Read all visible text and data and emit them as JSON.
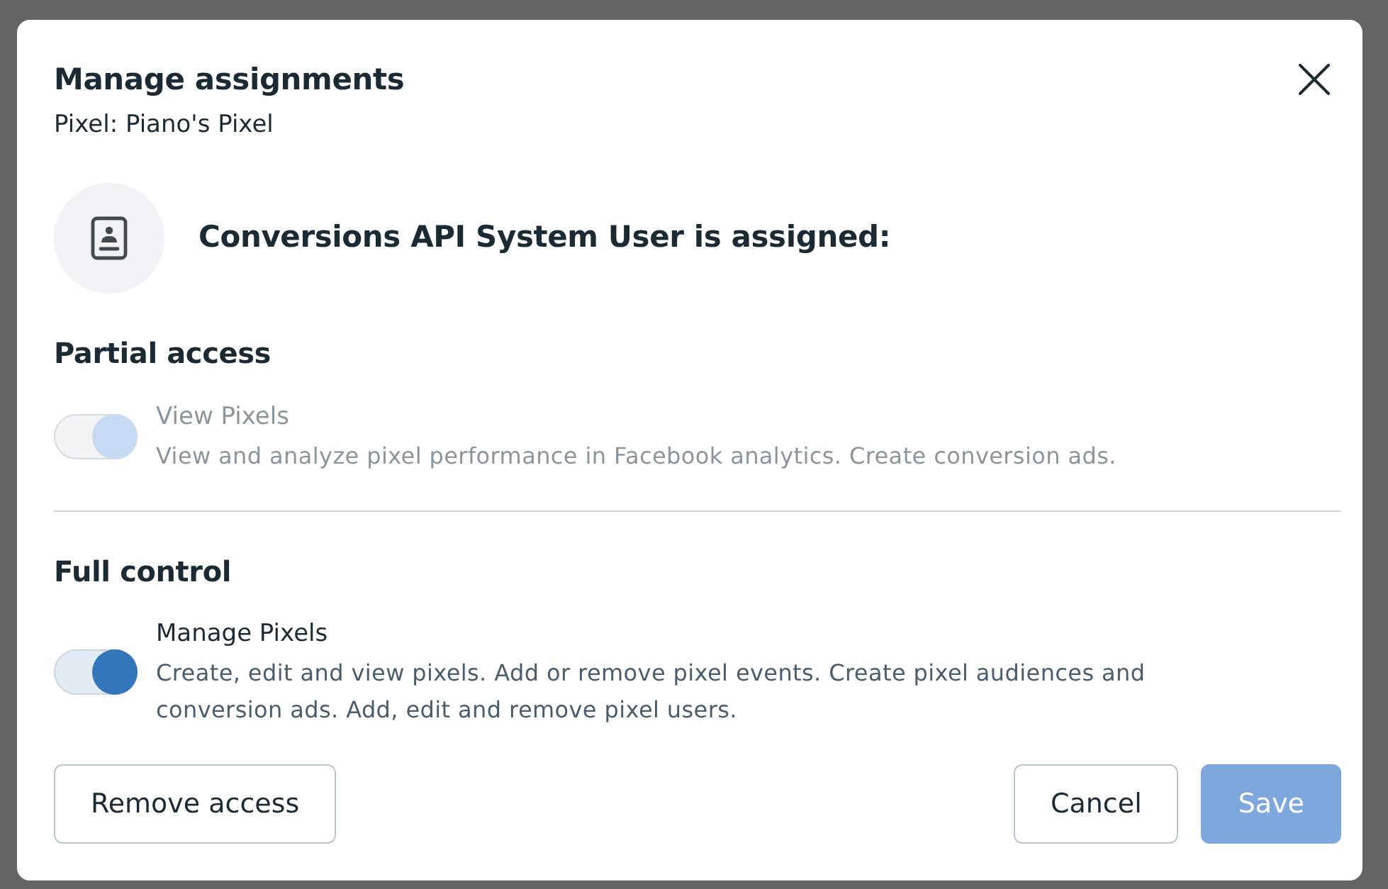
{
  "dialog": {
    "title": "Manage assignments",
    "subtitle": "Pixel: Piano's Pixel",
    "heading": "Conversions API System User is assigned:",
    "sections": [
      {
        "title": "Partial access",
        "permissions": [
          {
            "label": "View Pixels",
            "description": "View and analyze pixel performance in Facebook analytics. Create conversion ads.",
            "on": true,
            "disabled": true
          }
        ]
      },
      {
        "title": "Full control",
        "permissions": [
          {
            "label": "Manage Pixels",
            "description": "Create, edit and view pixels. Add or remove pixel events. Create pixel audiences and conversion ads. Add, edit and remove pixel users.",
            "on": true,
            "disabled": false
          }
        ]
      }
    ],
    "footer": {
      "left_buttons": [
        {
          "label": "Remove access",
          "kind": "secondary",
          "disabled": false
        }
      ],
      "right_buttons": [
        {
          "label": "Cancel",
          "kind": "secondary",
          "disabled": false
        },
        {
          "label": "Save",
          "kind": "primary",
          "disabled": true
        }
      ]
    }
  }
}
